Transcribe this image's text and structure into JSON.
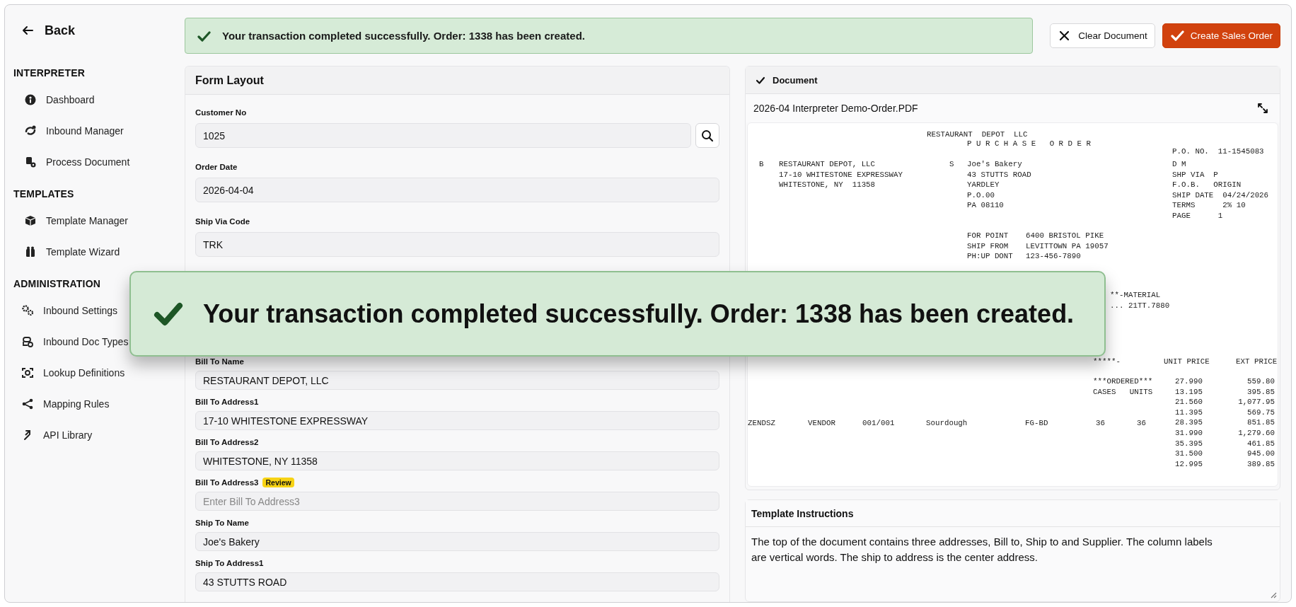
{
  "sidebar": {
    "back": "Back",
    "sections": [
      {
        "title": "INTERPRETER",
        "items": [
          "Dashboard",
          "Inbound Manager",
          "Process Document"
        ]
      },
      {
        "title": "TEMPLATES",
        "items": [
          "Template Manager",
          "Template Wizard"
        ]
      },
      {
        "title": "ADMINISTRATION",
        "items": [
          "Inbound Settings",
          "Inbound Doc Types",
          "Lookup Definitions",
          "Mapping Rules",
          "API Library"
        ]
      }
    ]
  },
  "toast": {
    "message": "Your transaction completed successfully. Order: 1338 has been created."
  },
  "actions": [
    {
      "label": "Clear Document",
      "kind": "secondary"
    },
    {
      "label": "Create Sales Order",
      "kind": "primary"
    }
  ],
  "form": {
    "title": "Form Layout",
    "groups": [
      [
        {
          "label": "Customer No",
          "value": "1025",
          "kind": "lookup"
        },
        {
          "label": "Order Date",
          "value": "2026-04-04",
          "kind": "text"
        },
        {
          "label": "Ship Via Code",
          "value": "TRK",
          "kind": "text"
        }
      ],
      [
        {
          "label": "Bill To Name",
          "value": "RESTAURANT DEPOT, LLC",
          "kind": "text"
        },
        {
          "label": "Bill To Address1",
          "value": "17-10 WHITESTONE EXPRESSWAY",
          "kind": "text"
        },
        {
          "label": "Bill To Address2",
          "value": "WHITESTONE, NY 11358",
          "kind": "text"
        },
        {
          "label": "Bill To Address3",
          "placeholder": "Enter Bill To Address3",
          "badge": "Review",
          "kind": "text"
        },
        {
          "label": "Ship To Name",
          "value": "Joe's Bakery",
          "kind": "text"
        },
        {
          "label": "Ship To Address1",
          "value": "43 STUTTS ROAD",
          "kind": "text"
        }
      ]
    ]
  },
  "document": {
    "title": "Document",
    "file_name": "2026-04 Interpreter Demo-Order.PDF",
    "blocks": [
      {
        "kind": "lines",
        "lines": [
          "RESTAURANT  DEPOT  LLC"
        ]
      },
      {
        "kind": "lines",
        "lines": [
          "P U R C H A S E   O R D E R"
        ]
      },
      {
        "kind": "lines",
        "lines": [
          "P.O. NO.  11-1545083"
        ]
      },
      {
        "kind": "lines",
        "lines": [
          "B"
        ]
      },
      {
        "kind": "lines",
        "lines": [
          "RESTAURANT DEPOT, LLC",
          "17-10 WHITESTONE EXPRESSWAY",
          "WHITESTONE, NY  11358"
        ]
      },
      {
        "kind": "lines",
        "lines": [
          "S"
        ]
      },
      {
        "kind": "lines",
        "lines": [
          "Joe's Bakery",
          "43 STUTTS ROAD",
          "YARDLEY",
          "P.O.00",
          "PA 08110"
        ]
      },
      {
        "kind": "lines",
        "lines": [
          "D M",
          "SHP VIA  P",
          "F.O.B.   ORIGIN",
          "SHIP DATE  04/24/2026",
          "TERMS      2% 10",
          "PAGE      1"
        ]
      },
      {
        "kind": "pairs",
        "pairs": [
          [
            "FOR POINT",
            "6400 BRISTOL PIKE"
          ],
          [
            "SHIP FROM",
            "LEVITTOWN PA 19057"
          ],
          [
            "PH:UP DONT",
            "123-456-7890"
          ]
        ]
      },
      {
        "kind": "lines",
        "lines": [
          "**-MATERIAL",
          "... 21TT.7880"
        ]
      },
      {
        "kind": "lines",
        "lines": [
          "*****-"
        ]
      },
      {
        "kind": "lines",
        "lines": [
          "UNIT PRICE"
        ]
      },
      {
        "kind": "lines",
        "lines": [
          "EXT PRICE"
        ]
      },
      {
        "kind": "lines",
        "lines": [
          "***ORDERED***",
          "CASES   UNITS"
        ]
      },
      {
        "kind": "row",
        "cells": [
          "ZENDSZ",
          "VENDOR",
          "001/001",
          "Sourdough",
          "FG-BD",
          "36",
          "36"
        ]
      },
      {
        "kind": "column",
        "lines": [
          "27.990",
          "13.195",
          "21.560",
          "11.395",
          "28.395",
          "31.990",
          "35.395",
          "31.500",
          "12.995"
        ]
      },
      {
        "kind": "column",
        "lines": [
          "559.80",
          "395.85",
          "1,077.95",
          "569.75",
          "851.85",
          "1,279.60",
          "461.85",
          "945.00",
          "389.85"
        ]
      }
    ]
  },
  "instructions": {
    "title": "Template Instructions",
    "text": "The top of the document contains three addresses, Bill to, Ship to and Supplier. The column labels are vertical words. The ship to address is the center address."
  },
  "callout": {
    "message": "Your transaction completed successfully. Order: 1338 has been created."
  }
}
